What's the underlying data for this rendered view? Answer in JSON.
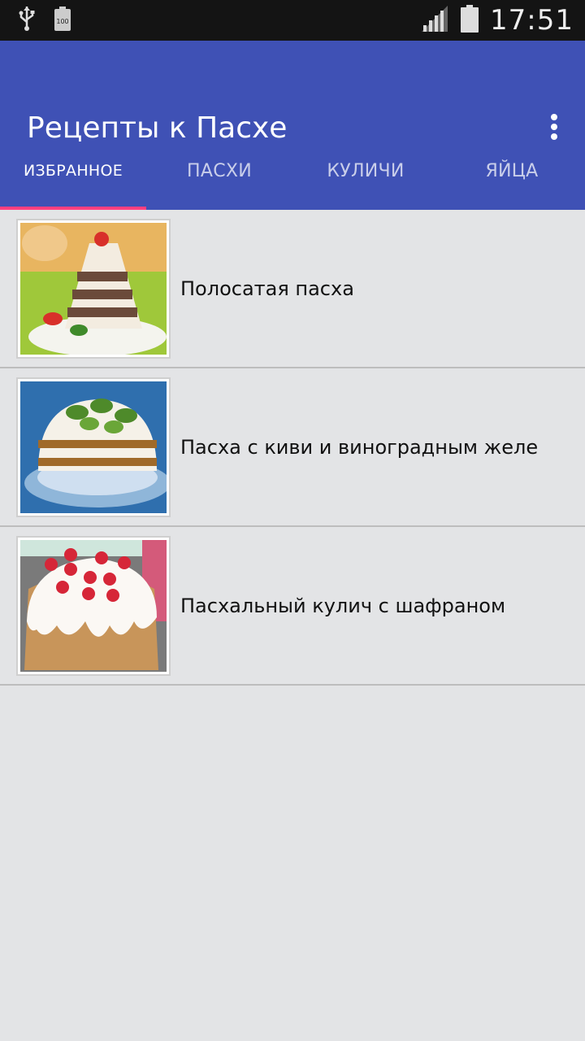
{
  "status_bar": {
    "time": "17:51",
    "battery_text": "100",
    "icons": [
      "usb-icon",
      "battery-saver-icon",
      "signal-icon",
      "battery-icon"
    ]
  },
  "app_bar": {
    "title": "Рецепты к Пасхе",
    "menu_icon": "more-vert-icon",
    "color": "#3f51b5"
  },
  "tabs": [
    {
      "label": "ИЗБРАННОЕ",
      "active": true
    },
    {
      "label": "ПАСХИ",
      "active": false
    },
    {
      "label": "КУЛИЧИ",
      "active": false
    },
    {
      "label": "ЯЙЦА",
      "active": false
    }
  ],
  "tab_indicator_color": "#ff4081",
  "recipes": [
    {
      "title": "Полосатая пасха"
    },
    {
      "title": "Пасха с киви и виноградным желе"
    },
    {
      "title": "Пасхальный кулич с шафраном"
    }
  ]
}
